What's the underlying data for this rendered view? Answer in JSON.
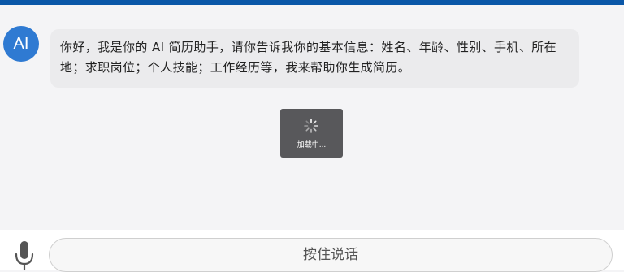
{
  "chat": {
    "avatar_label": "AI",
    "messages": [
      {
        "sender": "AI",
        "text": "你好，我是你的 AI 简历助手，请你告诉我你的基本信息：姓名、年龄、性别、手机、所在地；求职岗位；个人技能；工作经历等，我来帮助你生成简历。"
      }
    ]
  },
  "loading": {
    "label": "加载中..."
  },
  "input_bar": {
    "hold_to_talk_label": "按住说话",
    "mic_icon": "microphone-icon"
  },
  "colors": {
    "top_bar": "#0a57a8",
    "avatar": "#2f7ad2",
    "bubble": "#ebebed",
    "toast": "#58585b"
  }
}
